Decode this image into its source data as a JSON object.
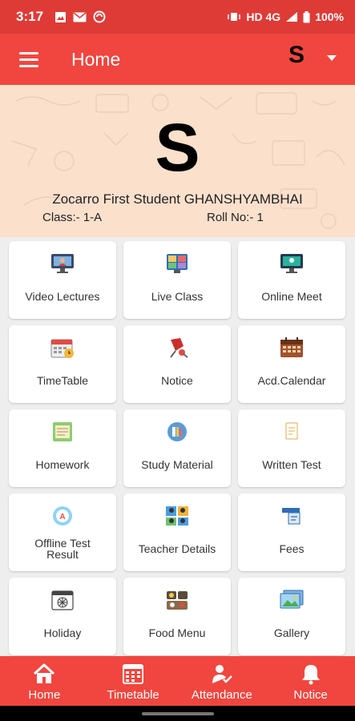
{
  "status_bar": {
    "time": "3:17",
    "network": "HD 4G",
    "battery": "100%"
  },
  "app_bar": {
    "title": "Home",
    "avatar_letter": "S"
  },
  "profile": {
    "initial": "S",
    "name": "Zocarro First Student GHANSHYAMBHAI",
    "class_text": "Class:- 1-A",
    "roll_text": "Roll No:- 1"
  },
  "tiles": [
    {
      "label": "Video Lectures",
      "icon": "video-lecture-icon"
    },
    {
      "label": "Live Class",
      "icon": "live-class-icon"
    },
    {
      "label": "Online Meet",
      "icon": "online-meet-icon"
    },
    {
      "label": "TimeTable",
      "icon": "timetable-icon"
    },
    {
      "label": "Notice",
      "icon": "notice-pin-icon"
    },
    {
      "label": "Acd.Calendar",
      "icon": "calendar-icon"
    },
    {
      "label": "Homework",
      "icon": "homework-icon"
    },
    {
      "label": "Study Material",
      "icon": "study-material-icon"
    },
    {
      "label": "Written Test",
      "icon": "written-test-icon"
    },
    {
      "label": "Offline Test",
      "label2": "Result",
      "icon": "offline-test-icon"
    },
    {
      "label": "Teacher Details",
      "icon": "teacher-details-icon"
    },
    {
      "label": "Fees",
      "icon": "fees-icon"
    },
    {
      "label": "Holiday",
      "icon": "holiday-icon"
    },
    {
      "label": "Food Menu",
      "icon": "food-menu-icon"
    },
    {
      "label": "Gallery",
      "icon": "gallery-icon"
    }
  ],
  "bottom_nav": [
    {
      "label": "Home",
      "icon": "home-icon"
    },
    {
      "label": "Timetable",
      "icon": "timetable-grid-icon"
    },
    {
      "label": "Attendance",
      "icon": "attendance-icon"
    },
    {
      "label": "Notice",
      "icon": "bell-icon"
    }
  ],
  "colors": {
    "primary": "#f0463f",
    "status_bar": "#de3b37",
    "profile_bg": "#fbe0cc"
  }
}
